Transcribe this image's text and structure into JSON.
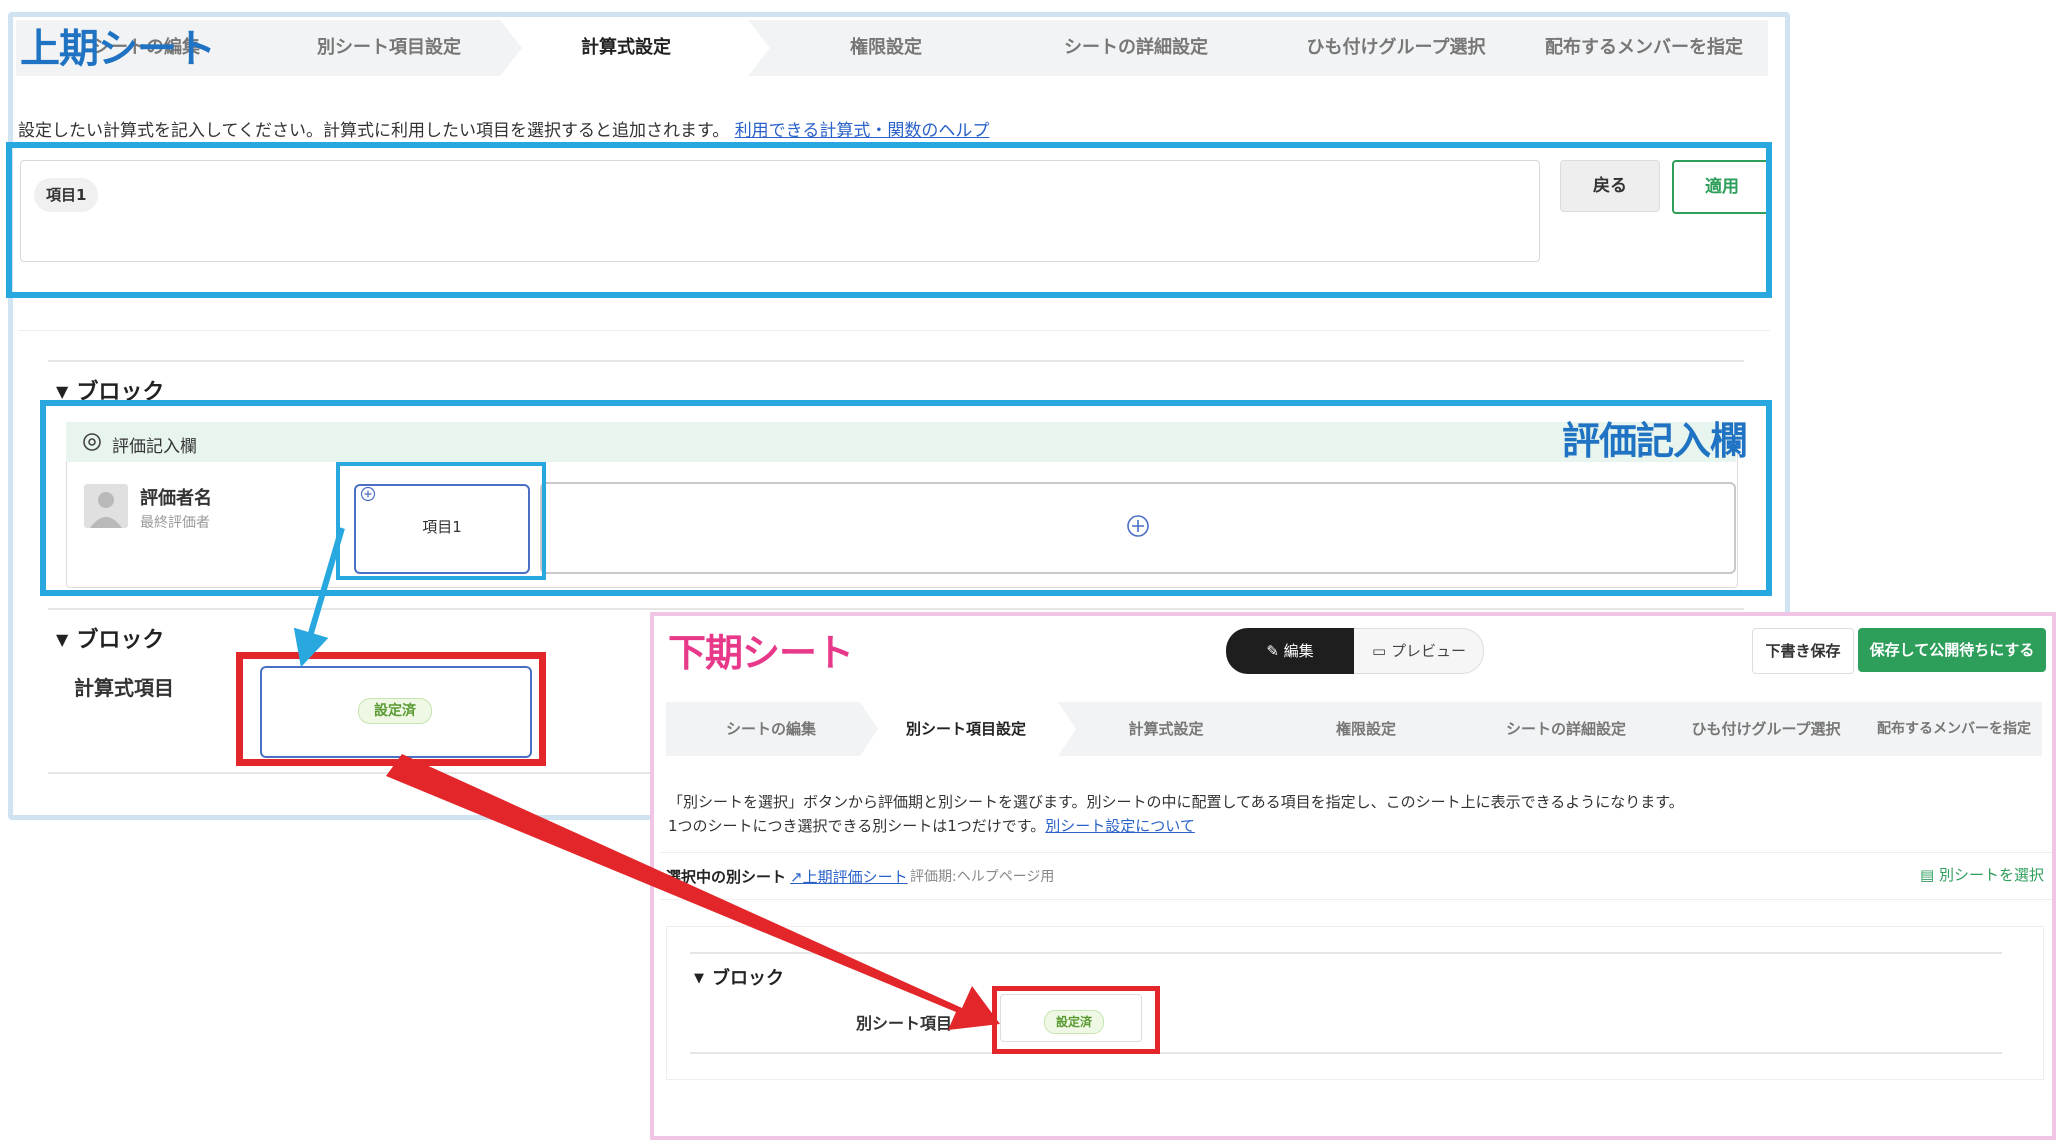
{
  "upper_sheet": {
    "annotation_title": "上期シート",
    "steps": [
      {
        "label": "シートの編集"
      },
      {
        "label": "別シート項目設定"
      },
      {
        "label": "計算式設定",
        "active": true
      },
      {
        "label": "権限設定"
      },
      {
        "label": "シートの詳細設定"
      },
      {
        "label": "ひも付けグループ選択"
      },
      {
        "label": "配布するメンバーを指定"
      }
    ],
    "instruction": "設定したい計算式を記入してください。計算式に利用したい項目を選択すると追加されます。",
    "help_link": "利用できる計算式・関数のヘルプ",
    "formula_chip": "項目1",
    "back_button": "戻る",
    "apply_button": "適用",
    "block1_title": "ブロック",
    "eval_section_label": "評価記入欄",
    "evaluator_name": "評価者名",
    "evaluator_sub": "最終評価者",
    "item_card_label": "項目1",
    "block2_title": "ブロック",
    "formula_item_label": "計算式項目",
    "formula_badge": "設定済",
    "eval_annotation_label": "評価記入欄"
  },
  "lower_sheet": {
    "annotation_title": "下期シート",
    "edit_tab": "編集",
    "preview_tab": "プレビュー",
    "draft_save_button": "下書き保存",
    "publish_button": "保存して公開待ちにする",
    "steps": [
      {
        "label": "シートの編集"
      },
      {
        "label": "別シート項目設定",
        "active": true
      },
      {
        "label": "計算式設定"
      },
      {
        "label": "権限設定"
      },
      {
        "label": "シートの詳細設定"
      },
      {
        "label": "ひも付けグループ選択"
      },
      {
        "label": "配布するメンバーを指定"
      }
    ],
    "instruction_line1": "「別シートを選択」ボタンから評価期と別シートを選びます。別シートの中に配置してある項目を指定し、このシート上に表示できるようになります。",
    "instruction_line2": "1つのシートにつき選択できる別シートは1つだけです。",
    "instruction_link": "別シート設定について",
    "selected_label": "選択中の別シート",
    "selected_sheet_link": "上期評価シート",
    "selected_period": "評価期:ヘルプページ用",
    "select_sheet_button": "別シートを選択",
    "block_title": "ブロック",
    "item_label": "別シート項目",
    "item_badge": "設定済"
  },
  "colors": {
    "annotation_blue": "#29a8e0",
    "annotation_red": "#e3262a",
    "upper_title": "#1f73c2",
    "lower_title": "#e8388a",
    "apply_green": "#2e9e5b",
    "link_blue": "#2a62c9"
  }
}
